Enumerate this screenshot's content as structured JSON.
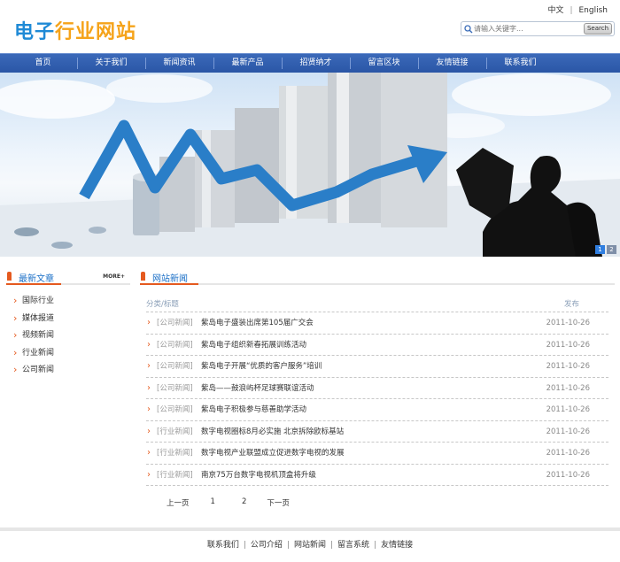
{
  "header": {
    "logo_part1": "电子",
    "logo_part2": "行业网站",
    "lang_cn": "中文",
    "lang_sep": "|",
    "lang_en": "English",
    "search_placeholder": "请输入关键字...",
    "search_button": "Search"
  },
  "nav": [
    "首页",
    "关于我们",
    "新闻资讯",
    "最新产品",
    "招贤纳才",
    "留言区块",
    "友情链接",
    "联系我们"
  ],
  "banner": {
    "dots": [
      "1",
      "2"
    ],
    "active_dot": 0
  },
  "left": {
    "title": "最新文章",
    "more": "MORE+",
    "items": [
      "国际行业",
      "媒体报道",
      "视频新闻",
      "行业新闻",
      "公司新闻"
    ]
  },
  "right": {
    "title": "网站新闻",
    "col_title": "分类/标题",
    "col_date": "发布",
    "rows": [
      {
        "cat": "[公司新闻]",
        "title": "紫岛电子盛装出席第105届广交会",
        "date": "2011-10-26"
      },
      {
        "cat": "[公司新闻]",
        "title": "紫岛电子组织新春拓展训练活动",
        "date": "2011-10-26"
      },
      {
        "cat": "[公司新闻]",
        "title": "紫岛电子开展“优质的客户服务”培训",
        "date": "2011-10-26"
      },
      {
        "cat": "[公司新闻]",
        "title": "紫岛——鼓浪屿杯足球赛联谊活动",
        "date": "2011-10-26"
      },
      {
        "cat": "[公司新闻]",
        "title": "紫岛电子积极参与慈善助学活动",
        "date": "2011-10-26"
      },
      {
        "cat": "[行业新闻]",
        "title": "数字电视圈标8月必实施 北京拆除欧标基站",
        "date": "2011-10-26"
      },
      {
        "cat": "[行业新闻]",
        "title": "数字电视产业联盟成立促进数字电视的发展",
        "date": "2011-10-26"
      },
      {
        "cat": "[行业新闻]",
        "title": "南京75万台数字电视机顶盒将升级",
        "date": "2011-10-26"
      }
    ],
    "pager": {
      "prev": "上一页",
      "p1": "1",
      "p2": "2",
      "next": "下一页"
    }
  },
  "footer": [
    "联系我们",
    "公司介绍",
    "网站新闻",
    "留言系统",
    "友情链接"
  ],
  "colors": {
    "nav": "#2f5fb0",
    "accent": "#e55a1f",
    "title_blue": "#1a6fc7",
    "logo_blue": "#1f8ad6",
    "logo_orange": "#f5a31a"
  }
}
